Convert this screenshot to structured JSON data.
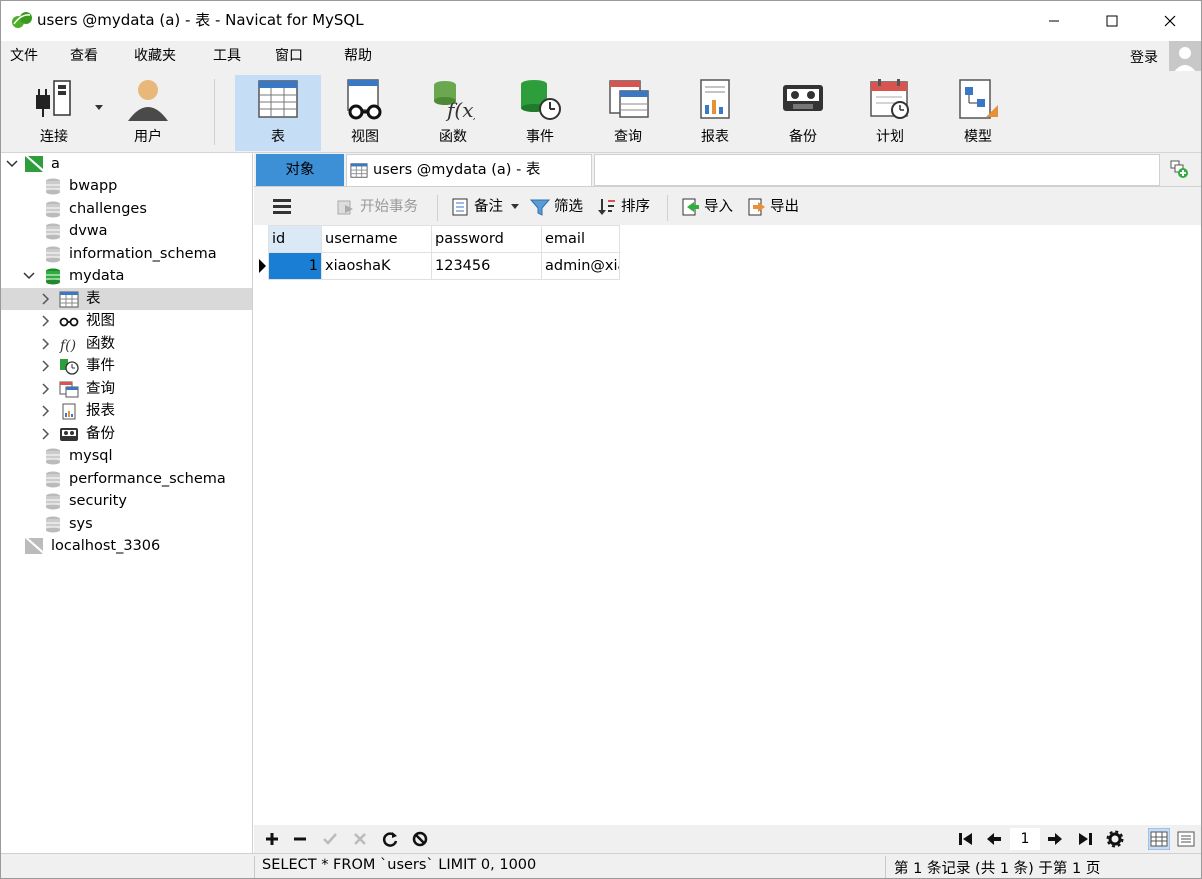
{
  "window": {
    "title": "users @mydata (a) - 表 - Navicat for MySQL"
  },
  "menu": [
    "文件",
    "查看",
    "收藏夹",
    "工具",
    "窗口",
    "帮助"
  ],
  "login": "登录",
  "toolbar": {
    "items": [
      {
        "label": "连接",
        "icon": "plug-icon"
      },
      {
        "label": "用户",
        "icon": "user-icon"
      },
      {
        "label": "表",
        "icon": "table-icon",
        "active": true
      },
      {
        "label": "视图",
        "icon": "glasses-icon"
      },
      {
        "label": "函数",
        "icon": "function-icon"
      },
      {
        "label": "事件",
        "icon": "event-icon"
      },
      {
        "label": "查询",
        "icon": "query-icon"
      },
      {
        "label": "报表",
        "icon": "report-icon"
      },
      {
        "label": "备份",
        "icon": "backup-icon"
      },
      {
        "label": "计划",
        "icon": "schedule-icon"
      },
      {
        "label": "模型",
        "icon": "model-icon"
      }
    ]
  },
  "tree": {
    "connection": "a",
    "databases_before": [
      "bwapp",
      "challenges",
      "dvwa",
      "information_schema"
    ],
    "open_db": "mydata",
    "open_db_children": [
      "表",
      "视图",
      "函数",
      "事件",
      "查询",
      "报表",
      "备份"
    ],
    "databases_after": [
      "mysql",
      "performance_schema",
      "security",
      "sys"
    ],
    "other_connection": "localhost_3306"
  },
  "tabs": {
    "objects": "对象",
    "active": "users @mydata (a) - 表"
  },
  "subtoolbar": {
    "begin_tx": "开始事务",
    "note": "备注",
    "filter": "筛选",
    "sort": "排序",
    "import": "导入",
    "export": "导出"
  },
  "grid": {
    "columns": [
      "id",
      "username",
      "password",
      "email"
    ],
    "rows": [
      [
        "1",
        "xiaoshaK",
        "123456",
        "admin@xia"
      ]
    ]
  },
  "pager": {
    "page": "1"
  },
  "status": {
    "sql": "SELECT * FROM `users` LIMIT 0, 1000",
    "records": "第 1 条记录 (共 1 条) 于第 1 页"
  },
  "colors": {
    "accent": "#3d8fd6",
    "selected_cell": "#1a7fd4",
    "toolbar_active": "#c5def5"
  }
}
